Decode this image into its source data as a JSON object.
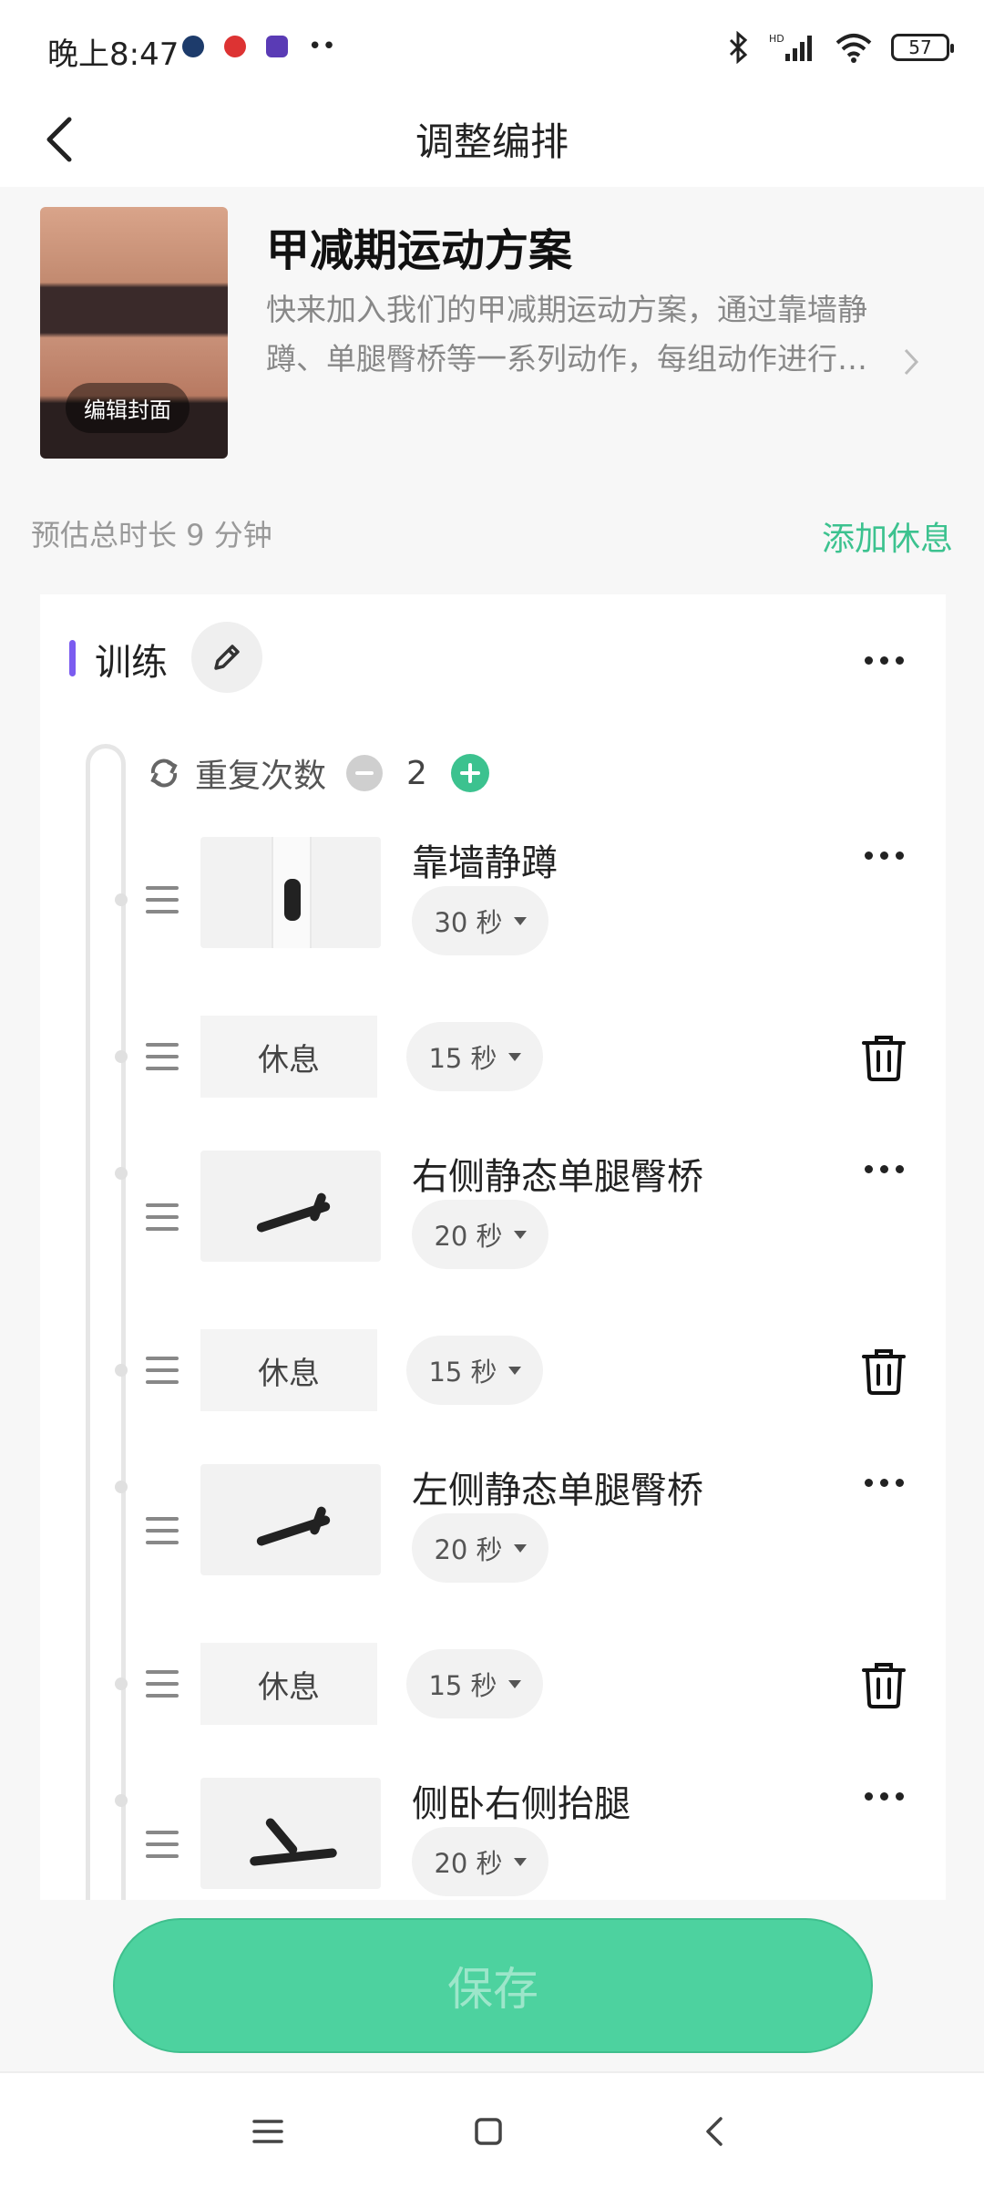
{
  "status_bar": {
    "time": "晚上8:47",
    "battery": "57"
  },
  "header": {
    "title": "调整编排"
  },
  "plan": {
    "cover_edit_label": "编辑封面",
    "name": "甲减期运动方案",
    "description": "快来加入我们的甲减期运动方案，通过靠墙静蹲、单腿臀桥等一系列动作，每组动作进行…"
  },
  "summary": {
    "duration": "预估总时长 9 分钟",
    "add_rest": "添加休息"
  },
  "section": {
    "title": "训练",
    "repeat_label": "重复次数",
    "repeat_count": "2"
  },
  "items": [
    {
      "type": "exercise",
      "name": "靠墙静蹲",
      "duration": "30 秒"
    },
    {
      "type": "rest",
      "name": "休息",
      "duration": "15 秒"
    },
    {
      "type": "exercise",
      "name": "右侧静态单腿臀桥",
      "duration": "20 秒"
    },
    {
      "type": "rest",
      "name": "休息",
      "duration": "15 秒"
    },
    {
      "type": "exercise",
      "name": "左侧静态单腿臀桥",
      "duration": "20 秒"
    },
    {
      "type": "rest",
      "name": "休息",
      "duration": "15 秒"
    },
    {
      "type": "exercise",
      "name": "侧卧右侧抬腿",
      "duration": "20 秒"
    }
  ],
  "save_label": "保存",
  "colors": {
    "accent": "#3cc28f",
    "section_bar": "#7b5cf0",
    "save_button": "#4dd29f"
  }
}
